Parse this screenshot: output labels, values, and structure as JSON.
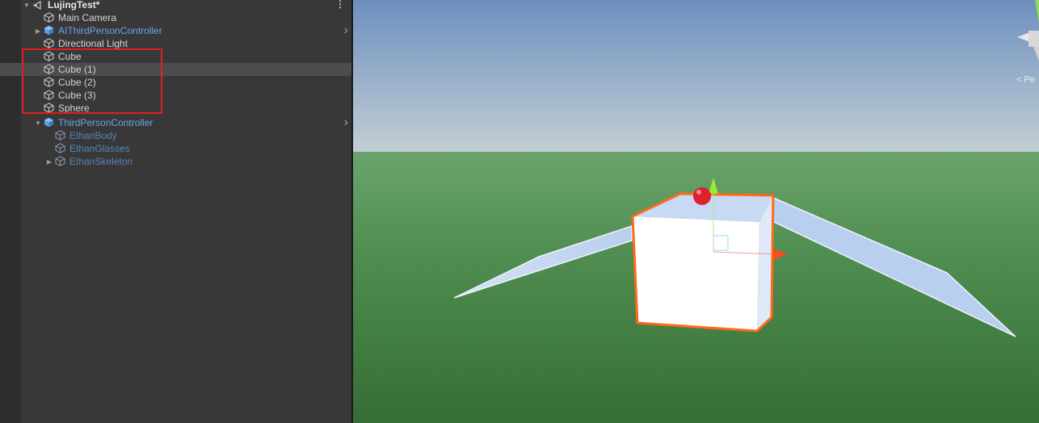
{
  "hierarchy": {
    "scene_name": "LujingTest*",
    "items": [
      {
        "label": "Main Camera",
        "type": "object",
        "indent": 0
      },
      {
        "label": "AIThirdPersonController",
        "type": "prefab",
        "indent": 0,
        "expandable": true
      },
      {
        "label": "Directional Light",
        "type": "object",
        "indent": 0
      },
      {
        "label": "Cube",
        "type": "object",
        "indent": 0
      },
      {
        "label": "Cube (1)",
        "type": "object",
        "indent": 0,
        "selected": true
      },
      {
        "label": "Cube (2)",
        "type": "object",
        "indent": 0
      },
      {
        "label": "Cube (3)",
        "type": "object",
        "indent": 0
      },
      {
        "label": "Sphere",
        "type": "object",
        "indent": 0
      },
      {
        "label": "ThirdPersonController",
        "type": "prefab",
        "indent": 0,
        "expanded": true
      },
      {
        "label": "EthanBody",
        "type": "prefab-child",
        "indent": 1
      },
      {
        "label": "EthanGlasses",
        "type": "prefab-child",
        "indent": 1
      },
      {
        "label": "EthanSkeleton",
        "type": "prefab-child",
        "indent": 1,
        "expandable": true
      }
    ]
  },
  "scene_view": {
    "gizmo_label": "< Pe",
    "selection_color": "#ff6a1a",
    "sky_color": "#7d9cc4",
    "ground_color": "#4a8a4a"
  },
  "colors": {
    "annotation_box": "#e11f1f"
  }
}
